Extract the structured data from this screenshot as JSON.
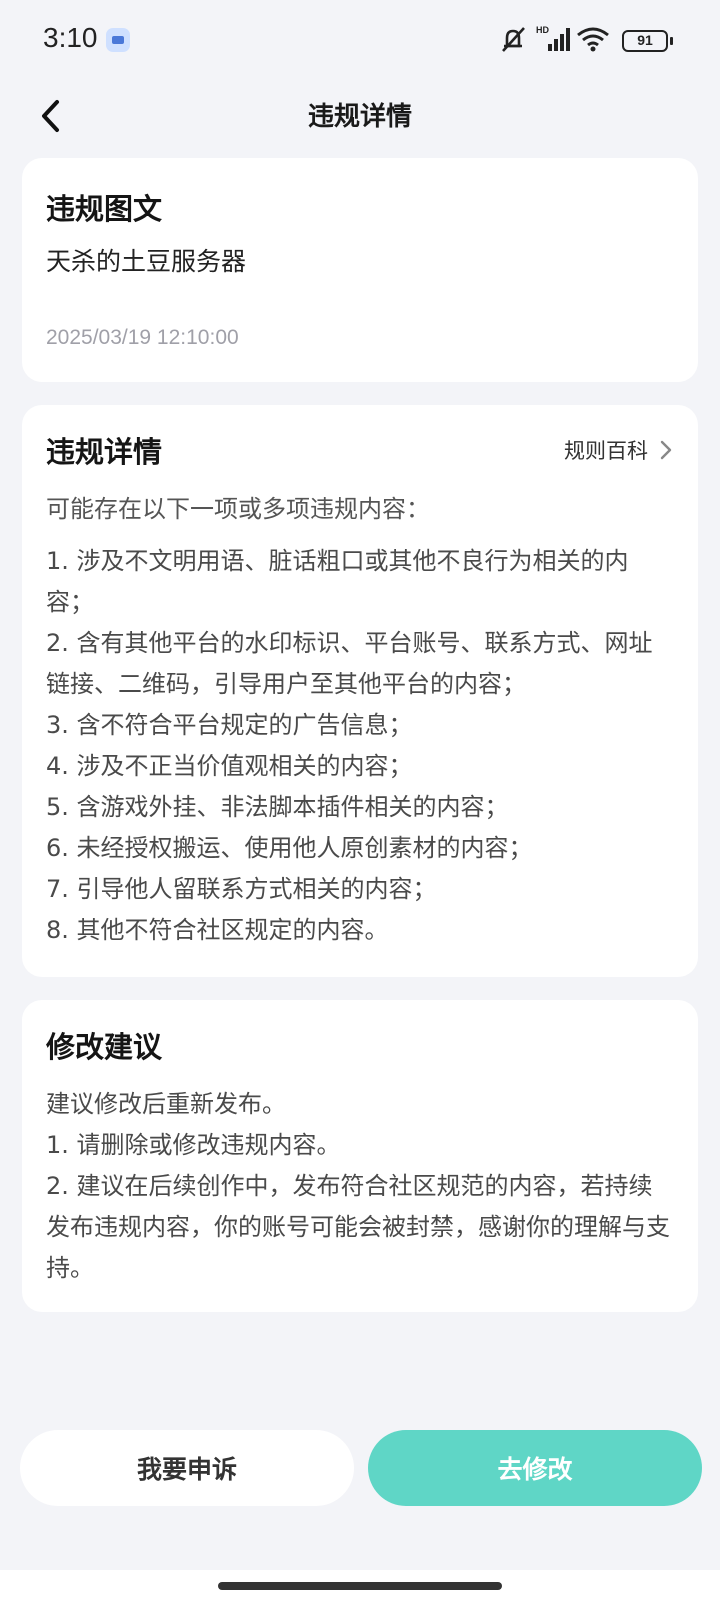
{
  "status_bar": {
    "time": "3:10",
    "battery": "91",
    "icons": [
      "app-notification-icon",
      "mute-icon",
      "cellular-signal-icon",
      "wifi-icon",
      "battery-icon"
    ]
  },
  "header": {
    "title": "违规详情",
    "back_icon": "chevron-left-icon"
  },
  "post_card": {
    "title": "违规图文",
    "content": "天杀的土豆服务器",
    "timestamp": "2025/03/19 12:10:00"
  },
  "details_card": {
    "title": "违规详情",
    "rules_link": "规则百科",
    "lead": "可能存在以下一项或多项违规内容：",
    "items": [
      "1. 涉及不文明用语、脏话粗口或其他不良行为相关的内容；",
      "2. 含有其他平台的水印标识、平台账号、联系方式、网址链接、二维码，引导用户至其他平台的内容；",
      "3. 含不符合平台规定的广告信息；",
      "4. 涉及不正当价值观相关的内容；",
      "5. 含游戏外挂、非法脚本插件相关的内容；",
      "6. 未经授权搬运、使用他人原创素材的内容；",
      "7. 引导他人留联系方式相关的内容；",
      "8. 其他不符合社区规定的内容。"
    ]
  },
  "advice_card": {
    "title": "修改建议",
    "lines": [
      "建议修改后重新发布。",
      "1. 请删除或修改违规内容。",
      "2. 建议在后续创作中，发布符合社区规范的内容，若持续发布违规内容，你的账号可能会被封禁，感谢你的理解与支持。"
    ]
  },
  "actions": {
    "appeal": "我要申诉",
    "modify": "去修改"
  },
  "colors": {
    "accent": "#5fd6c6",
    "background": "#f3f4f8",
    "card": "#ffffff"
  }
}
